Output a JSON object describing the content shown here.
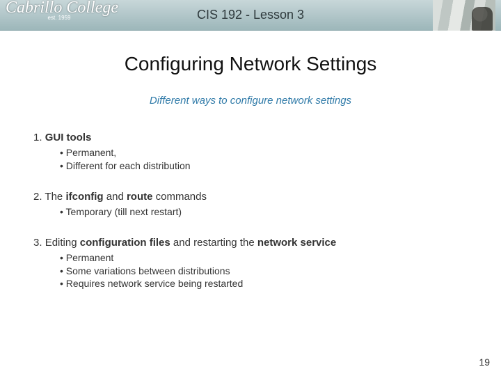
{
  "banner": {
    "logo_text": "Cabrillo College",
    "logo_sub": "est. 1959",
    "title": "CIS 192 - Lesson 3"
  },
  "title": "Configuring Network Settings",
  "subtitle": "Different ways to configure network settings",
  "items": [
    {
      "num": "1.",
      "head_html": "<span class=\"bold\">GUI tools</span>",
      "subs": [
        "Permanent,",
        "Different for each distribution"
      ]
    },
    {
      "num": "2.",
      "head_html": "The <span class=\"bold\">ifconfig</span> and <span class=\"bold\">route</span> commands",
      "subs": [
        "Temporary (till next restart)"
      ]
    },
    {
      "num": "3.",
      "head_html": "Editing <span class=\"bold\">configuration files</span> and restarting the <span class=\"bold\">network service</span>",
      "subs": [
        "Permanent",
        "Some variations between distributions",
        "Requires network service being restarted"
      ]
    }
  ],
  "page_number": "19"
}
